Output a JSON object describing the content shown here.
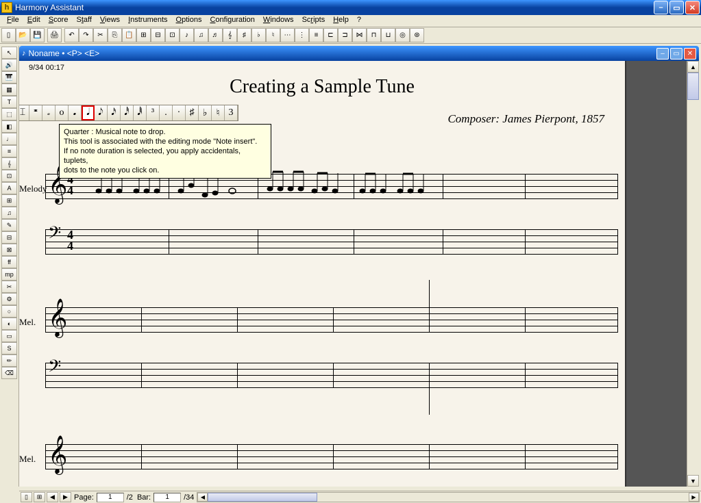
{
  "app": {
    "title": "Harmony Assistant"
  },
  "menu": {
    "items": [
      "File",
      "Edit",
      "Score",
      "Staff",
      "Views",
      "Instruments",
      "Options",
      "Configuration",
      "Windows",
      "Scripts",
      "Help",
      "?"
    ]
  },
  "inner_window": {
    "title": "Noname • <P> <E>"
  },
  "timecode": "9/34 00:17",
  "score": {
    "title": "Creating a Sample Tune",
    "composer": "Composer: James Pierpont, 1857",
    "staff1_label": "Melody",
    "staff2_label": "Mel.",
    "staff3_label": "Mel.",
    "time_signature": {
      "num": "4",
      "den": "4"
    }
  },
  "tooltip": {
    "title": "Quarter : Musical note to drop.",
    "line2": " This tool is associated with the editing mode \"Note insert\".",
    "line3": "If no note duration is selected, you apply accidentals, tuplets,",
    "line4": "dots to the note you click on."
  },
  "note_palette": [
    "⌶",
    "𝄺",
    "𝅗",
    "o",
    "𝅘",
    "𝅘𝅥",
    "𝅘𝅥𝅮",
    "𝅘𝅥𝅯",
    "𝅘𝅥𝅰",
    "𝅘𝅥𝅱",
    "³",
    ".",
    "·",
    "♯",
    "♭",
    "♮",
    "3"
  ],
  "statusbar": {
    "page_label": "Page:",
    "page_value": "1",
    "page_total": "/2",
    "bar_label": "Bar:",
    "bar_value": "1",
    "bar_total": "/34"
  },
  "left_tools": [
    "↖",
    "🔊",
    "🎹",
    "▦",
    "T",
    "⬚",
    "◧",
    "♩",
    "≡",
    "𝄞",
    "⊡",
    "A",
    "⊞",
    "♫",
    "✎",
    "⊟",
    "⊠",
    "ff",
    "mp",
    "✂",
    "⚙",
    "○",
    "◐",
    "▭",
    "S",
    "✏",
    "⌫"
  ]
}
